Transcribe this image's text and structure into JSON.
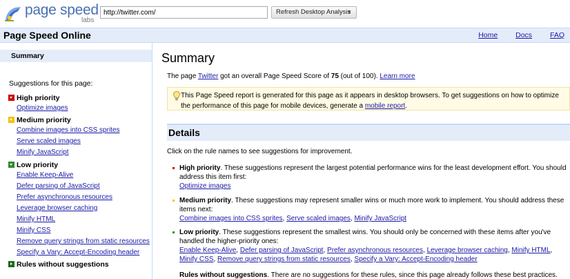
{
  "header": {
    "logo_text": "page speed",
    "logo_sub": "labs",
    "url_value": "http://twitter.com/",
    "analyze_label": "Refresh Desktop Analysis",
    "analyze_caret": "▼"
  },
  "titlebar": {
    "title": "Page Speed Online",
    "nav": {
      "home": "Home",
      "docs": "Docs",
      "faq": "FAQ"
    }
  },
  "sidebar": {
    "summary": "Summary",
    "heading": "Suggestions for this page:",
    "high": {
      "label": "High priority",
      "items": [
        "Optimize images"
      ]
    },
    "medium": {
      "label": "Medium priority",
      "items": [
        "Combine images into CSS sprites",
        "Serve scaled images",
        "Minify JavaScript"
      ]
    },
    "low": {
      "label": "Low priority",
      "items": [
        "Enable Keep-Alive",
        "Defer parsing of JavaScript",
        "Prefer asynchronous resources",
        "Leverage browser caching",
        "Minify HTML",
        "Minify CSS",
        "Remove query strings from static resources",
        "Specify a Vary: Accept-Encoding header"
      ]
    },
    "none": {
      "label": "Rules without suggestions"
    }
  },
  "main": {
    "summary_title": "Summary",
    "score": {
      "prefix": "The page ",
      "site": "Twitter",
      "mid": " got an overall Page Speed Score of ",
      "value": "75",
      "suffix": " (out of 100). ",
      "learn_more": "Learn more"
    },
    "notice": {
      "text": "This Page Speed report is generated for this page as it appears in desktop browsers. To get suggestions on how to optimize the performance of this page for mobile devices, generate a ",
      "link": "mobile report",
      "end": "."
    },
    "details_title": "Details",
    "details_intro": "Click on the rule names to see suggestions for improvement.",
    "high": {
      "label": "High priority",
      "text": ". These suggestions represent the largest potential performance wins for the least development effort. You should address this item first:",
      "links": [
        "Optimize images"
      ]
    },
    "medium": {
      "label": "Medium priority",
      "text": ". These suggestions may represent smaller wins or much more work to implement. You should address these items next:",
      "links": [
        "Combine images into CSS sprites",
        "Serve scaled images",
        "Minify JavaScript"
      ]
    },
    "low": {
      "label": "Low priority",
      "text": ". These suggestions represent the smallest wins. You should only be concerned with these items after you've handled the higher-priority ones:",
      "links": [
        "Enable Keep-Alive",
        "Defer parsing of JavaScript",
        "Prefer asynchronous resources",
        "Leverage browser caching",
        "Minify HTML",
        "Minify CSS",
        "Remove query strings from static resources",
        "Specify a Vary: Accept-Encoding header"
      ]
    },
    "none": {
      "label": "Rules without suggestions",
      "text": ". There are no suggestions for these rules, since this page already follows these best practices. Good"
    },
    "separator": ", "
  },
  "colors": {
    "link": "#1a1aa6",
    "title_bar": "#e5ecf9",
    "high": "#cc0000",
    "medium": "#f2c200",
    "low": "#2f8a2f",
    "notice_bg": "#fffbe5"
  }
}
